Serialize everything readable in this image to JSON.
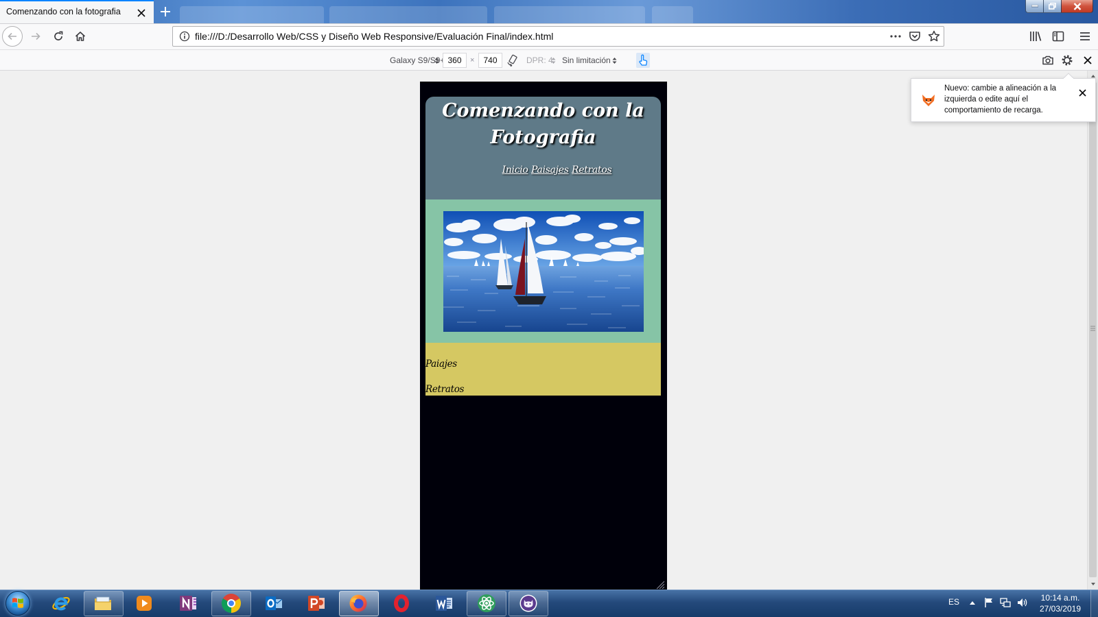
{
  "browser": {
    "tab_title": "Comenzando con la fotografia",
    "url": "file:///D:/Desarrollo Web/CSS y Diseño Web Responsive/Evaluación Final/index.html"
  },
  "responsive": {
    "device": "Galaxy S9/S9+",
    "width": "360",
    "times": "×",
    "height": "740",
    "dpr": "DPR: 4",
    "throttling": "Sin limitación"
  },
  "notification": {
    "text": "Nuevo: cambie a alineación a la izquierda o edite aquí el comportamiento de recarga."
  },
  "page": {
    "title_lines": [
      "Comenzando con la",
      "Fotografia"
    ],
    "nav": [
      "Inicio",
      "Paisajes",
      "Retratos"
    ],
    "links": [
      "Paiajes",
      "Retratos"
    ]
  },
  "taskbar": {
    "language": "ES",
    "time": "10:14 a.m.",
    "date": "27/03/2019",
    "apps": [
      "internet-explorer-icon",
      "file-explorer-icon",
      "media-player-icon",
      "onenote-icon",
      "chrome-icon",
      "outlook-icon",
      "powerpoint-icon",
      "firefox-icon",
      "opera-icon",
      "word-icon",
      "atom-icon",
      "github-desktop-icon"
    ],
    "running": [
      "file-explorer-icon",
      "chrome-icon",
      "firefox-icon",
      "atom-icon",
      "github-desktop-icon"
    ],
    "active": "firefox-icon"
  },
  "icons": {
    "toolbar": [
      "back-icon",
      "forward-icon",
      "reload-icon",
      "home-icon",
      "info-icon",
      "more-actions-icon",
      "pocket-icon",
      "bookmark-star-icon",
      "library-icon",
      "sidebar-icon",
      "menu-icon"
    ],
    "responsive": [
      "updown-icon",
      "rotate-icon",
      "touch-simulation-icon",
      "screenshot-camera-icon",
      "settings-gear-icon",
      "close-icon"
    ],
    "tray": [
      "show-hidden-icons-arrow",
      "action-center-flag-icon",
      "network-icon",
      "volume-icon"
    ]
  },
  "colors": {
    "header": "#5f7a88",
    "hero_background": "#86c4a6",
    "links_background": "#d5c862",
    "device_background": "#00000a",
    "browser_accent": "#0a84ff"
  }
}
